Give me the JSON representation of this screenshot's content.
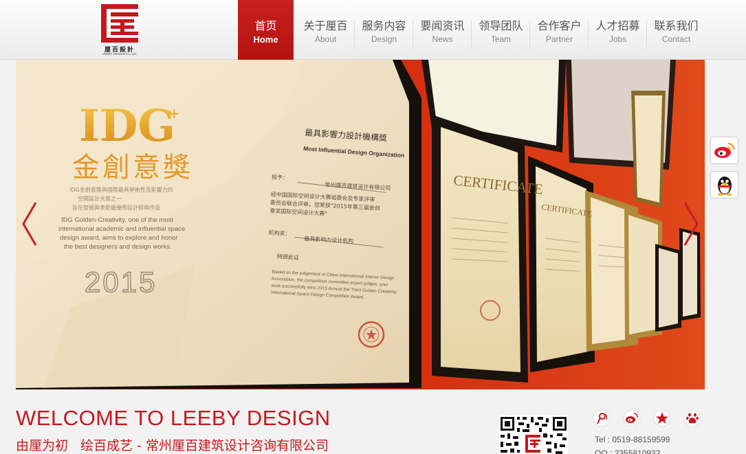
{
  "logo": {
    "cn": "厘百設計",
    "en": "LEEBY DESIGN Co.,Ltd.",
    "brand_color": "#c8161d"
  },
  "nav": [
    {
      "cn": "首页",
      "en": "Home",
      "active": true
    },
    {
      "cn": "关于厘百",
      "en": "About"
    },
    {
      "cn": "服务内容",
      "en": "Design"
    },
    {
      "cn": "要闻资讯",
      "en": "News"
    },
    {
      "cn": "领导团队",
      "en": "Team"
    },
    {
      "cn": "合作客户",
      "en": "Partner"
    },
    {
      "cn": "人才招募",
      "en": "Jobs"
    },
    {
      "cn": "联系我们",
      "en": "Contact"
    }
  ],
  "banner": {
    "idg": "IDG",
    "idg_cn": "金創意獎",
    "year": "2015",
    "award_title": "最具影響力設計機構獎",
    "award_en": "Most Influential Design Organization",
    "certificate": "CERTIFICATE",
    "idg_desc": "IDG Golden-Creativity, one of the most international academic and influential space design award, aims to explore and honor the best designers and design works."
  },
  "side": {
    "weibo_icon": "weibo-icon",
    "qq_icon": "qq-icon"
  },
  "footer": {
    "welcome": "WELCOME TO LEEBY DESIGN",
    "slogan_a": "由厘为初",
    "slogan_b": "绘百成艺 - 常州厘百建筑设计咨询有限公司",
    "tel": "Tel : 0519-88159599",
    "qq": "QQ : 2355810932",
    "social_icons": [
      "tencent-weibo-icon",
      "sina-weibo-icon",
      "star-icon",
      "baidu-paw-icon"
    ]
  }
}
